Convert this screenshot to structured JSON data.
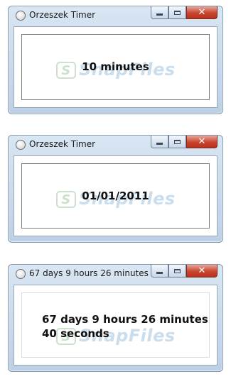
{
  "watermark": {
    "badge": "S",
    "text": "SnapFiles"
  },
  "windows": [
    {
      "title": "Orzeszek Timer",
      "display": "10 minutes"
    },
    {
      "title": "Orzeszek Timer",
      "display": "01/01/2011"
    },
    {
      "title": "67 days 9 hours 26 minutes ...",
      "display_line1": "67 days 9 hours 26 minutes",
      "display_line2": "40 seconds"
    }
  ],
  "caption_buttons": {
    "minimize": "minimize-icon",
    "maximize": "maximize-icon",
    "close": "close-icon"
  },
  "colors": {
    "frame": "#bcd0e6",
    "close_button": "#c9452f"
  }
}
